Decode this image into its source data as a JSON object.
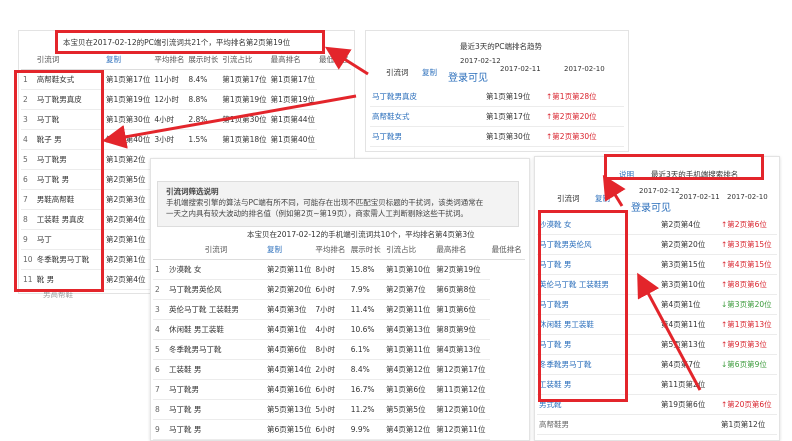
{
  "pc_panel": {
    "summary": "本宝贝在2017-02-12的PC端引流词共21个，平均排名第2页第19位",
    "headers": [
      "引流词",
      "复制",
      "平均排名",
      "展示时长",
      "引流占比",
      "最高排名",
      "最低排名"
    ],
    "rows": [
      {
        "idx": "1",
        "kw": "高帮鞋女式",
        "avg": "第1页第17位",
        "dur": "11小时",
        "pct": "8.4%",
        "hi": "第1页第17位",
        "lo": "第1页第17位"
      },
      {
        "idx": "2",
        "kw": "马丁靴男真皮",
        "avg": "第1页第19位",
        "dur": "12小时",
        "pct": "8.8%",
        "hi": "第1页第19位",
        "lo": "第1页第19位"
      },
      {
        "idx": "3",
        "kw": "马丁靴",
        "avg": "第1页第30位",
        "dur": "4小时",
        "pct": "2.8%",
        "hi": "第1页第30位",
        "lo": "第1页第44位"
      },
      {
        "idx": "4",
        "kw": "靴子 男",
        "avg": "第1页第40位",
        "dur": "3小时",
        "pct": "1.5%",
        "hi": "第1页第18位",
        "lo": "第1页第40位"
      },
      {
        "idx": "5",
        "kw": "马丁靴男",
        "avg": "第1页第2位",
        "dur": "",
        "pct": "",
        "hi": "",
        "lo": ""
      },
      {
        "idx": "6",
        "kw": "马丁靴 男",
        "avg": "第2页第5位",
        "dur": "",
        "pct": "",
        "hi": "",
        "lo": ""
      },
      {
        "idx": "7",
        "kw": "男鞋高帮鞋",
        "avg": "第2页第3位",
        "dur": "",
        "pct": "",
        "hi": "",
        "lo": ""
      },
      {
        "idx": "8",
        "kw": "工装鞋 男真皮",
        "avg": "第2页第4位",
        "dur": "",
        "pct": "",
        "hi": "",
        "lo": ""
      },
      {
        "idx": "9",
        "kw": "马丁",
        "avg": "第2页第1位",
        "dur": "",
        "pct": "",
        "hi": "",
        "lo": ""
      },
      {
        "idx": "10",
        "kw": "冬季靴男马丁靴",
        "avg": "第2页第1位",
        "dur": "",
        "pct": "",
        "hi": "",
        "lo": ""
      },
      {
        "idx": "11",
        "kw": "靴 男",
        "avg": "第2页第4位",
        "dur": "",
        "pct": "",
        "hi": "",
        "lo": ""
      }
    ],
    "partial_row": "男高帮鞋"
  },
  "pc_trend": {
    "title": "最近3天的PC端排名趋势",
    "col_kw": "引流词",
    "copy": "复制",
    "date1": "2017-02-12",
    "login": "登录可见",
    "date2": "2017-02-11",
    "date3": "2017-02-10",
    "rows": [
      {
        "kw": "马丁靴男真皮",
        "d2": "第1页第19位",
        "d3": "第1页第28位",
        "dir": "up"
      },
      {
        "kw": "高帮鞋女式",
        "d2": "第1页第17位",
        "d3": "第2页第20位",
        "dir": "up"
      },
      {
        "kw": "马丁靴男",
        "d2": "第1页第30位",
        "d3": "第2页第30位",
        "dir": "up"
      }
    ]
  },
  "mobile_panel": {
    "note_title": "引流词筛选说明",
    "note_body1": "手机端搜索引擎的算法与PC端有所不同，可能存在出现不匹配宝贝标题的干扰词，该类词通常在",
    "note_body2": "一天之内具有较大波动的排名值（例如第2页~第19页），商家需人工判断剔除这些干扰词。",
    "summary": "本宝贝在2017-02-12的手机端引流词共10个，平均排名第4页第3位",
    "headers": [
      "引流词",
      "复制",
      "平均排名",
      "展示时长",
      "引流占比",
      "最高排名",
      "最低排名"
    ],
    "rows": [
      {
        "idx": "1",
        "kw": "沙漠靴 女",
        "avg": "第2页第11位",
        "dur": "8小时",
        "pct": "15.8%",
        "hi": "第1页第10位",
        "lo": "第2页第19位"
      },
      {
        "idx": "2",
        "kw": "马丁靴男英伦风",
        "avg": "第2页第20位",
        "dur": "6小时",
        "pct": "7.9%",
        "hi": "第2页第7位",
        "lo": "第6页第8位"
      },
      {
        "idx": "3",
        "kw": "英伦马丁靴 工装鞋男",
        "avg": "第4页第3位",
        "dur": "7小时",
        "pct": "11.4%",
        "hi": "第2页第11位",
        "lo": "第1页第6位"
      },
      {
        "idx": "4",
        "kw": "休闲鞋 男工装鞋",
        "avg": "第4页第1位",
        "dur": "4小时",
        "pct": "10.6%",
        "hi": "第4页第13位",
        "lo": "第8页第9位"
      },
      {
        "idx": "5",
        "kw": "冬季靴男马丁靴",
        "avg": "第4页第6位",
        "dur": "8小时",
        "pct": "6.1%",
        "hi": "第1页第11位",
        "lo": "第4页第13位"
      },
      {
        "idx": "6",
        "kw": "工装鞋 男",
        "avg": "第4页第14位",
        "dur": "2小时",
        "pct": "8.4%",
        "hi": "第4页第12位",
        "lo": "第12页第17位"
      },
      {
        "idx": "7",
        "kw": "马丁靴男",
        "avg": "第4页第16位",
        "dur": "6小时",
        "pct": "16.7%",
        "hi": "第1页第6位",
        "lo": "第11页第12位"
      },
      {
        "idx": "8",
        "kw": "马丁靴 男",
        "avg": "第5页第13位",
        "dur": "5小时",
        "pct": "11.2%",
        "hi": "第5页第5位",
        "lo": "第12页第10位"
      },
      {
        "idx": "9",
        "kw": "马丁靴 男",
        "avg": "第6页第15位",
        "dur": "6小时",
        "pct": "9.9%",
        "hi": "第4页第12位",
        "lo": "第12页第11位"
      }
    ]
  },
  "mobile_trend": {
    "link_desc": "说明",
    "title": "最近3天的手机端搜索排名",
    "col_kw": "引流词",
    "copy": "复制",
    "date1": "2017-02-12",
    "login": "登录可见",
    "date2": "2017-02-11",
    "date3": "2017-02-10",
    "rows": [
      {
        "kw": "沙漠靴 女",
        "d2": "第2页第4位",
        "d3": "第2页第6位",
        "dir": "up"
      },
      {
        "kw": "马丁靴男英伦风",
        "d2": "第2页第20位",
        "d3": "第3页第15位",
        "dir": "up"
      },
      {
        "kw": "马丁靴 男",
        "d2": "第3页第15位",
        "d3": "第4页第15位",
        "dir": "up"
      },
      {
        "kw": "英伦马丁靴 工装鞋男",
        "d2": "第3页第10位",
        "d3": "第8页第6位",
        "dir": "up"
      },
      {
        "kw": "马丁靴男",
        "d2": "第4页第1位",
        "d3": "第3页第20位",
        "dir": "down"
      },
      {
        "kw": "休闲鞋 男工装鞋",
        "d2": "第4页第11位",
        "d3": "第1页第13位",
        "dir": "up"
      },
      {
        "kw": "马丁靴 男",
        "d2": "第5页第13位",
        "d3": "第9页第3位",
        "dir": "up"
      },
      {
        "kw": "冬季靴男马丁靴",
        "d2": "第4页第7位",
        "d3": "第6页第9位",
        "dir": "down"
      },
      {
        "kw": "工装鞋 男",
        "d2": "第11页第2位",
        "d3": "",
        "dir": ""
      },
      {
        "kw": "男式靴",
        "d2": "第19页第6位",
        "d3": "第20页第6位",
        "dir": "up"
      }
    ],
    "extra_kw": "高帮鞋男",
    "extra_val": "第1页第12位"
  },
  "colors": {
    "highlight": "#e3252b",
    "link": "#2a6ebb",
    "up": "#d9232d",
    "down": "#3a9a3a"
  }
}
